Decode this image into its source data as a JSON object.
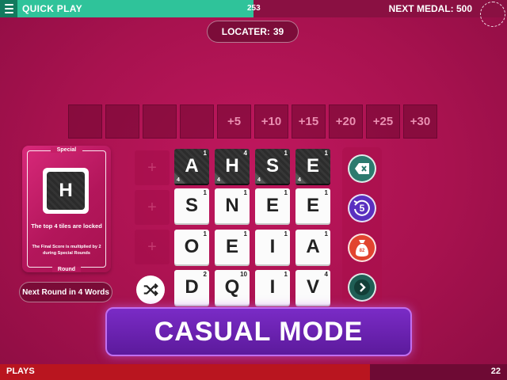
{
  "header": {
    "mode_title": "QUICK PLAY",
    "score": "253",
    "next_medal_label": "NEXT MEDAL:",
    "next_medal_value": "500",
    "progress_fraction": 0.5
  },
  "locater": {
    "label": "LOCATER:",
    "value": "39"
  },
  "bonus_slots": [
    "",
    "",
    "",
    "",
    "+5",
    "+10",
    "+15",
    "+20",
    "+25",
    "+30"
  ],
  "special_card": {
    "label_top": "Special",
    "tile_letter": "H",
    "text_main": "The top 4 tiles are locked",
    "text_sub": "The Final Score is multiplied by 2 during Special Rounds",
    "label_bottom": "Round"
  },
  "next_round": "Next Round in 4 Words",
  "board": [
    [
      {
        "l": "A",
        "p": "1",
        "locked": true,
        "lock": "4"
      },
      {
        "l": "H",
        "p": "4",
        "locked": true,
        "lock": "4"
      },
      {
        "l": "S",
        "p": "1",
        "locked": true,
        "lock": "4"
      },
      {
        "l": "E",
        "p": "1",
        "locked": true,
        "lock": "4"
      }
    ],
    [
      {
        "l": "S",
        "p": "1"
      },
      {
        "l": "N",
        "p": "1"
      },
      {
        "l": "E",
        "p": "1"
      },
      {
        "l": "E",
        "p": "1"
      }
    ],
    [
      {
        "l": "O",
        "p": "1"
      },
      {
        "l": "E",
        "p": "1"
      },
      {
        "l": "I",
        "p": "1"
      },
      {
        "l": "A",
        "p": "1"
      }
    ],
    [
      {
        "l": "D",
        "p": "2"
      },
      {
        "l": "Q",
        "p": "10"
      },
      {
        "l": "I",
        "p": "1"
      },
      {
        "l": "V",
        "p": "4"
      }
    ]
  ],
  "ghost_symbol": "+",
  "side_buttons": {
    "undo_count": "5",
    "bag_value": "82",
    "colors": {
      "delete": "#2c7a6e",
      "undo": "#5a2fc0",
      "bag": "#e2442f",
      "next": "#1f5e55"
    }
  },
  "banner": "CASUAL MODE",
  "footer": {
    "plays_label": "PLAYS",
    "plays_count": "22",
    "progress_fraction": 0.73
  }
}
